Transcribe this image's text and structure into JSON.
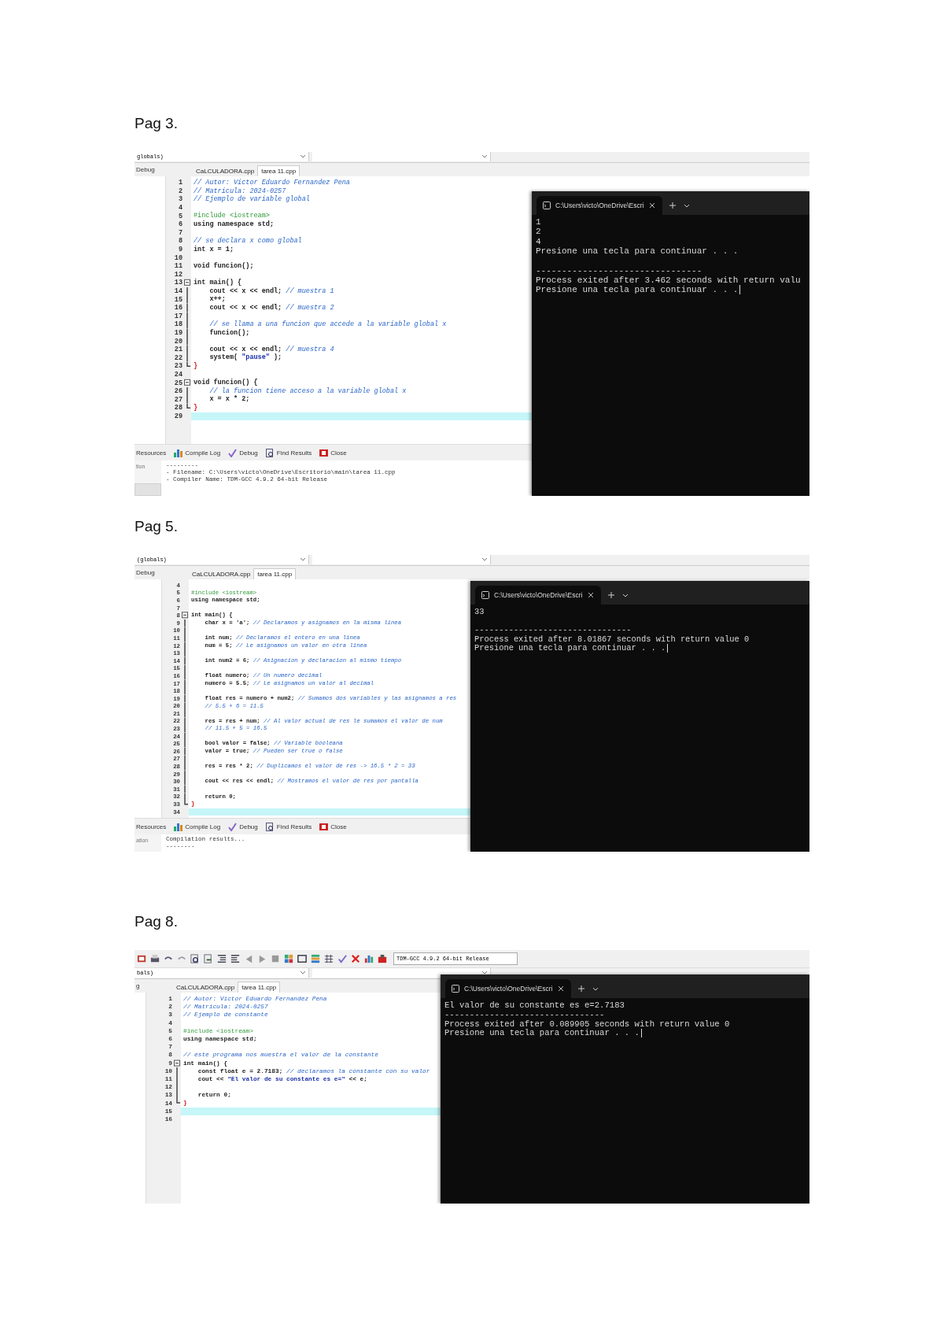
{
  "pages": [
    {
      "heading": "Pag 3.",
      "ide": {
        "scope": "globals)",
        "panel_tab": "Debug",
        "tabs": [
          {
            "label": "CaLCULADORA.cpp",
            "selected": false
          },
          {
            "label": "tarea 11.cpp",
            "selected": true
          }
        ],
        "lines": [
          {
            "n": "1",
            "kind": "plain",
            "current": false,
            "segs": [
              {
                "kind": "comment",
                "text": "// Autor: Victor Eduardo Fernandez Pena"
              }
            ]
          },
          {
            "n": "2",
            "kind": "plain",
            "current": false,
            "segs": [
              {
                "kind": "comment",
                "text": "// Matricula: 2024-0257"
              }
            ]
          },
          {
            "n": "3",
            "kind": "plain",
            "current": false,
            "segs": [
              {
                "kind": "comment",
                "text": "// Ejemplo de variable global"
              }
            ]
          },
          {
            "n": "4",
            "kind": "plain",
            "current": false
          },
          {
            "n": "5",
            "kind": "plain",
            "current": false,
            "segs": [
              {
                "kind": "pre",
                "text": "#include <iostream>"
              }
            ]
          },
          {
            "n": "6",
            "kind": "plain",
            "current": false,
            "segs": [
              {
                "kind": "code",
                "text": "using namespace std;"
              }
            ]
          },
          {
            "n": "7",
            "kind": "plain",
            "current": false
          },
          {
            "n": "8",
            "kind": "plain",
            "current": false,
            "segs": [
              {
                "kind": "comment",
                "text": "// se declara x como global"
              }
            ]
          },
          {
            "n": "9",
            "kind": "plain",
            "current": false,
            "segs": [
              {
                "kind": "code",
                "text": "int x = 1;"
              }
            ]
          },
          {
            "n": "10",
            "kind": "plain",
            "current": false
          },
          {
            "n": "11",
            "kind": "plain",
            "current": false,
            "segs": [
              {
                "kind": "code",
                "text": "void funcion();"
              }
            ]
          },
          {
            "n": "12",
            "kind": "plain",
            "current": false
          },
          {
            "n": "13",
            "kind": "fold_open",
            "current": false,
            "segs": [
              {
                "kind": "code",
                "text": "int main() {"
              }
            ]
          },
          {
            "n": "14",
            "kind": "fold_body",
            "current": false,
            "segs": [
              {
                "kind": "code",
                "text": "cout << x << endl;"
              },
              {
                "kind": "comment",
                "text": "// muestra 1"
              }
            ]
          },
          {
            "n": "15",
            "kind": "fold_body",
            "current": false,
            "segs": [
              {
                "kind": "code",
                "text": "x++;"
              }
            ]
          },
          {
            "n": "16",
            "kind": "fold_body",
            "current": false,
            "segs": [
              {
                "kind": "code",
                "text": "cout << x << endl;"
              },
              {
                "kind": "comment",
                "text": "// muestra 2"
              }
            ]
          },
          {
            "n": "17",
            "kind": "fold_body",
            "current": false
          },
          {
            "n": "18",
            "kind": "fold_body",
            "current": false,
            "segs": [
              {
                "kind": "comment",
                "text": "// se llama a una funcion que accede a la variable global x"
              }
            ]
          },
          {
            "n": "19",
            "kind": "fold_body",
            "current": false,
            "segs": [
              {
                "kind": "code",
                "text": "funcion();"
              }
            ]
          },
          {
            "n": "20",
            "kind": "fold_body",
            "current": false
          },
          {
            "n": "21",
            "kind": "fold_body",
            "current": false,
            "segs": [
              {
                "kind": "code",
                "text": "cout << x << endl;"
              },
              {
                "kind": "comment",
                "text": "// muestra 4"
              }
            ]
          },
          {
            "n": "22",
            "kind": "fold_body",
            "current": false,
            "segs": [
              {
                "kind": "code",
                "text": "system("
              },
              {
                "kind": "str",
                "text": "\"pause\""
              },
              {
                "kind": "code",
                "text": ");"
              }
            ]
          },
          {
            "n": "23",
            "kind": "fold_end",
            "current": false,
            "segs": [
              {
                "kind": "sym",
                "text": "}"
              }
            ]
          },
          {
            "n": "24",
            "kind": "plain",
            "current": false
          },
          {
            "n": "25",
            "kind": "fold_open",
            "current": false,
            "segs": [
              {
                "kind": "code",
                "text": "void funcion() {"
              }
            ]
          },
          {
            "n": "26",
            "kind": "fold_body",
            "current": false,
            "segs": [
              {
                "kind": "comment",
                "text": "// la funcion tiene acceso a la variable global x"
              }
            ]
          },
          {
            "n": "27",
            "kind": "fold_body",
            "current": false,
            "segs": [
              {
                "kind": "code",
                "text": "x = x * 2;"
              }
            ]
          },
          {
            "n": "28",
            "kind": "fold_end",
            "current": false,
            "segs": [
              {
                "kind": "sym",
                "text": "}"
              }
            ]
          },
          {
            "n": "29",
            "kind": "plain",
            "current": true
          }
        ],
        "bottom_tabs": [
          {
            "label": "Resources",
            "kind": "none"
          },
          {
            "label": "Compile Log",
            "kind": "chart"
          },
          {
            "label": "Debug",
            "kind": "check"
          },
          {
            "label": "Find Results",
            "kind": "find"
          },
          {
            "label": "Close",
            "kind": "close"
          }
        ],
        "panel_side": "tion",
        "log": [
          "---------",
          "- Filename: C:\\Users\\victo\\OneDrive\\Escritorio\\main\\tarea 11.cpp",
          "- Compiler Name: TDM-GCC 4.9.2 64-bit Release"
        ]
      },
      "terminal": {
        "title": "C:\\Users\\victo\\OneDrive\\Escri",
        "lines": [
          {
            "kind": "text",
            "text": "1"
          },
          {
            "kind": "text",
            "text": "2"
          },
          {
            "kind": "text",
            "text": "4"
          },
          {
            "kind": "text",
            "text": "Presione una tecla para continuar . . ."
          },
          {
            "kind": "blank"
          },
          {
            "kind": "text",
            "text": "--------------------------------"
          },
          {
            "kind": "text",
            "text": "Process exited after 3.462 seconds with return valu"
          },
          {
            "kind": "text",
            "text": "Presione una tecla para continuar . . ."
          }
        ],
        "cursor": true
      }
    },
    {
      "heading": "Pag 5.",
      "ide": {
        "scope": "(globals)",
        "panel_tab": "Debug",
        "tabs": [
          {
            "label": "CaLCULADORA.cpp",
            "selected": false
          },
          {
            "label": "tarea 11.cpp",
            "selected": true
          }
        ],
        "lines": [
          {
            "n": "4",
            "kind": "plain",
            "current": false
          },
          {
            "n": "5",
            "kind": "plain",
            "current": false,
            "segs": [
              {
                "kind": "pre",
                "text": "#include <iostream>"
              }
            ]
          },
          {
            "n": "6",
            "kind": "plain",
            "current": false,
            "segs": [
              {
                "kind": "code",
                "text": "using namespace std;"
              }
            ]
          },
          {
            "n": "7",
            "kind": "plain",
            "current": false
          },
          {
            "n": "8",
            "kind": "fold_open",
            "current": false,
            "segs": [
              {
                "kind": "code",
                "text": "int main() {"
              }
            ]
          },
          {
            "n": "9",
            "kind": "fold_body",
            "current": false,
            "segs": [
              {
                "kind": "code",
                "text": "char x = 'a';"
              },
              {
                "kind": "comment",
                "text": "// Declaramos y asignamos en la misma linea"
              }
            ]
          },
          {
            "n": "10",
            "kind": "fold_body",
            "current": false
          },
          {
            "n": "11",
            "kind": "fold_body",
            "current": false,
            "segs": [
              {
                "kind": "code",
                "text": "int num;"
              },
              {
                "kind": "comment",
                "text": "// Declaramos el entero en una linea"
              }
            ]
          },
          {
            "n": "12",
            "kind": "fold_body",
            "current": false,
            "segs": [
              {
                "kind": "code",
                "text": "num = 5;"
              },
              {
                "kind": "comment",
                "text": "// Le asignamos un valor en otra linea"
              }
            ]
          },
          {
            "n": "13",
            "kind": "fold_body",
            "current": false
          },
          {
            "n": "14",
            "kind": "fold_body",
            "current": false,
            "segs": [
              {
                "kind": "code",
                "text": "int num2 = 6;"
              },
              {
                "kind": "comment",
                "text": "// Asignacion y declaracion al mismo tiempo"
              }
            ]
          },
          {
            "n": "15",
            "kind": "fold_body",
            "current": false
          },
          {
            "n": "16",
            "kind": "fold_body",
            "current": false,
            "segs": [
              {
                "kind": "code",
                "text": "float numero;"
              },
              {
                "kind": "comment",
                "text": "// Un numero decimal"
              }
            ]
          },
          {
            "n": "17",
            "kind": "fold_body",
            "current": false,
            "segs": [
              {
                "kind": "code",
                "text": "numero = 5.5;"
              },
              {
                "kind": "comment",
                "text": "// Le asignamos un valor al decimal"
              }
            ]
          },
          {
            "n": "18",
            "kind": "fold_body",
            "current": false
          },
          {
            "n": "19",
            "kind": "fold_body",
            "current": false,
            "segs": [
              {
                "kind": "code",
                "text": "float res = numero + num2;"
              },
              {
                "kind": "comment",
                "text": "// Sumamos dos variables y las asignamos a res"
              }
            ]
          },
          {
            "n": "20",
            "kind": "fold_body",
            "current": false,
            "segs": [
              {
                "kind": "comment",
                "text": "// 5.5 + 6 = 11.5"
              }
            ]
          },
          {
            "n": "21",
            "kind": "fold_body",
            "current": false
          },
          {
            "n": "22",
            "kind": "fold_body",
            "current": false,
            "segs": [
              {
                "kind": "code",
                "text": "res = res + num;"
              },
              {
                "kind": "comment",
                "text": "// Al valor actual de res le sumamos el valor de num"
              }
            ]
          },
          {
            "n": "23",
            "kind": "fold_body",
            "current": false,
            "segs": [
              {
                "kind": "comment",
                "text": "// 11.5 + 5 = 16.5"
              }
            ]
          },
          {
            "n": "24",
            "kind": "fold_body",
            "current": false
          },
          {
            "n": "25",
            "kind": "fold_body",
            "current": false,
            "segs": [
              {
                "kind": "code",
                "text": "bool valor = false;"
              },
              {
                "kind": "comment",
                "text": "// Variable booleana"
              }
            ]
          },
          {
            "n": "26",
            "kind": "fold_body",
            "current": false,
            "segs": [
              {
                "kind": "code",
                "text": "valor = true;"
              },
              {
                "kind": "comment",
                "text": "// Pueden ser true o false"
              }
            ]
          },
          {
            "n": "27",
            "kind": "fold_body",
            "current": false
          },
          {
            "n": "28",
            "kind": "fold_body",
            "current": false,
            "segs": [
              {
                "kind": "code",
                "text": "res = res * 2;"
              },
              {
                "kind": "comment",
                "text": "// Duplicamos el valor de res -> 16.5 * 2 = 33"
              }
            ]
          },
          {
            "n": "29",
            "kind": "fold_body",
            "current": false
          },
          {
            "n": "30",
            "kind": "fold_body",
            "current": false,
            "segs": [
              {
                "kind": "code",
                "text": "cout << res << endl;"
              },
              {
                "kind": "comment",
                "text": "// Mostramos el valor de res por pantalla"
              }
            ]
          },
          {
            "n": "31",
            "kind": "fold_body",
            "current": false
          },
          {
            "n": "32",
            "kind": "fold_body",
            "current": false,
            "segs": [
              {
                "kind": "code",
                "text": "return 0;"
              }
            ]
          },
          {
            "n": "33",
            "kind": "fold_end",
            "current": false,
            "segs": [
              {
                "kind": "sym",
                "text": "}"
              }
            ]
          },
          {
            "n": "34",
            "kind": "plain",
            "current": true
          }
        ],
        "bottom_tabs": [
          {
            "label": "Resources",
            "kind": "none"
          },
          {
            "label": "Compile Log",
            "kind": "chart"
          },
          {
            "label": "Debug",
            "kind": "check"
          },
          {
            "label": "Find Results",
            "kind": "find"
          },
          {
            "label": "Close",
            "kind": "close"
          }
        ],
        "panel_side": "ation",
        "log": [
          "Compilation results...",
          "--------"
        ]
      },
      "terminal": {
        "title": "C:\\Users\\victo\\OneDrive\\Escri",
        "lines": [
          {
            "kind": "text",
            "text": "33"
          },
          {
            "kind": "blank"
          },
          {
            "kind": "text",
            "text": "--------------------------------"
          },
          {
            "kind": "text",
            "text": "Process exited after 8.01867 seconds with return value 0"
          },
          {
            "kind": "text",
            "text": "Presione una tecla para continuar . . ."
          }
        ],
        "cursor": true
      }
    },
    {
      "heading": "Pag 8.",
      "ide": {
        "toolbar": {
          "compiler": "TDM-GCC 4.9.2 64-bit Release"
        },
        "scope": "bals)",
        "panel_tab": "g",
        "tabs": [
          {
            "label": "CaLCULADORA.cpp",
            "selected": false
          },
          {
            "label": "tarea 11.cpp",
            "selected": true
          }
        ],
        "lines": [
          {
            "n": "1",
            "kind": "plain",
            "current": false,
            "segs": [
              {
                "kind": "comment",
                "text": "// Autor: Victor Eduardo Fernandez Pena"
              }
            ]
          },
          {
            "n": "2",
            "kind": "plain",
            "current": false,
            "segs": [
              {
                "kind": "comment",
                "text": "// Matricula: 2024-0257"
              }
            ]
          },
          {
            "n": "3",
            "kind": "plain",
            "current": false,
            "segs": [
              {
                "kind": "comment",
                "text": "// Ejemplo de constante"
              }
            ]
          },
          {
            "n": "4",
            "kind": "plain",
            "current": false
          },
          {
            "n": "5",
            "kind": "plain",
            "current": false,
            "segs": [
              {
                "kind": "pre",
                "text": "#include <iostream>"
              }
            ]
          },
          {
            "n": "6",
            "kind": "plain",
            "current": false,
            "segs": [
              {
                "kind": "code",
                "text": "using namespace std;"
              }
            ]
          },
          {
            "n": "7",
            "kind": "plain",
            "current": false
          },
          {
            "n": "8",
            "kind": "plain",
            "current": false,
            "segs": [
              {
                "kind": "comment",
                "text": "// este programa nos muestra el valor de la constante"
              }
            ]
          },
          {
            "n": "9",
            "kind": "fold_open",
            "current": false,
            "segs": [
              {
                "kind": "code",
                "text": "int main() {"
              }
            ]
          },
          {
            "n": "10",
            "kind": "fold_body",
            "current": false,
            "segs": [
              {
                "kind": "code",
                "text": "const float e = 2.7183;"
              },
              {
                "kind": "comment",
                "text": "// declaramos la constante con su valor"
              }
            ]
          },
          {
            "n": "11",
            "kind": "fold_body",
            "current": false,
            "segs": [
              {
                "kind": "code",
                "text": "cout <<"
              },
              {
                "kind": "str",
                "text": "\"El valor de su constante es e=\""
              },
              {
                "kind": "code",
                "text": "<< e;"
              }
            ]
          },
          {
            "n": "12",
            "kind": "fold_body",
            "current": false
          },
          {
            "n": "13",
            "kind": "fold_body",
            "current": false,
            "segs": [
              {
                "kind": "code",
                "text": "return 0;"
              }
            ]
          },
          {
            "n": "14",
            "kind": "fold_end",
            "current": false,
            "segs": [
              {
                "kind": "sym",
                "text": "}"
              }
            ]
          },
          {
            "n": "15",
            "kind": "plain",
            "current": true
          },
          {
            "n": "16",
            "kind": "plain",
            "current": false
          }
        ]
      },
      "terminal": {
        "title": "C:\\Users\\victo\\OneDrive\\Escri",
        "lines": [
          {
            "kind": "text",
            "text": "El valor de su constante es e=2.7183"
          },
          {
            "kind": "text",
            "text": "--------------------------------"
          },
          {
            "kind": "text",
            "text": "Process exited after 0.089905 seconds with return value 0"
          },
          {
            "kind": "text",
            "text": "Presione una tecla para continuar . . ."
          }
        ],
        "cursor": true
      }
    }
  ]
}
